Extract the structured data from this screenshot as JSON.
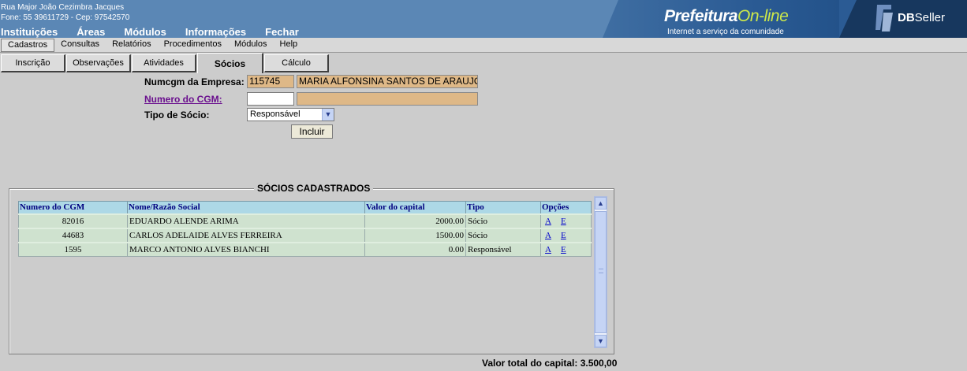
{
  "header": {
    "address_line1": "Rua Major João Cezimbra Jacques",
    "address_line2": "Fone: 55 39611729  -  Cep: 97542570",
    "nav": [
      "Instituições",
      "Áreas",
      "Módulos",
      "Informações",
      "Fechar"
    ],
    "brand_main": "Prefeitura",
    "brand_accent": "On-line",
    "brand_tagline": "Internet a serviço da comunidade",
    "dbseller_bold": "DB",
    "dbseller_rest": "Seller"
  },
  "menubar": [
    "Cadastros",
    "Consultas",
    "Relatórios",
    "Procedimentos",
    "Módulos",
    "Help"
  ],
  "tabs": [
    "Inscrição",
    "Observações",
    "Atividades",
    "Sócios",
    "Cálculo"
  ],
  "form": {
    "numcgm_label": "Numcgm da Empresa:",
    "numcgm_value": "115745",
    "empresa_nome": "MARIA ALFONSINA SANTOS DE ARAUJO",
    "numero_cgm_label": "Numero do CGM:",
    "numero_cgm_value": "",
    "numero_cgm_nome": "",
    "tipo_socio_label": "Tipo de Sócio:",
    "tipo_socio_value": "Responsável",
    "incluir_label": "Incluir"
  },
  "socios": {
    "legend": "SÓCIOS CADASTRADOS",
    "columns": [
      "Numero do CGM",
      "Nome/Razão Social",
      "Valor do capital",
      "Tipo",
      "Opções"
    ],
    "rows": [
      [
        "82016",
        "EDUARDO ALENDE ARIMA",
        "2000.00",
        "Sócio",
        "A",
        "E"
      ],
      [
        "44683",
        "CARLOS ADELAIDE ALVES FERREIRA",
        "1500.00",
        "Sócio",
        "A",
        "E"
      ],
      [
        "1595",
        "MARCO ANTONIO ALVES BIANCHI",
        "0.00",
        "Responsável",
        "A",
        "E"
      ]
    ],
    "total_label": "Valor total do capital: 3.500,00"
  },
  "icons": {
    "dropdown": "chevron-down-icon",
    "scroll_up": "chevron-up-icon",
    "scroll_down": "chevron-down-icon",
    "logo": "dbseller-logo"
  },
  "colors": {
    "header_bg": "#5b87b5",
    "readonly_field": "#deb887",
    "grid_header": "#add8e6",
    "grid_row": "#cfe2cf",
    "link": "#0000cc"
  }
}
